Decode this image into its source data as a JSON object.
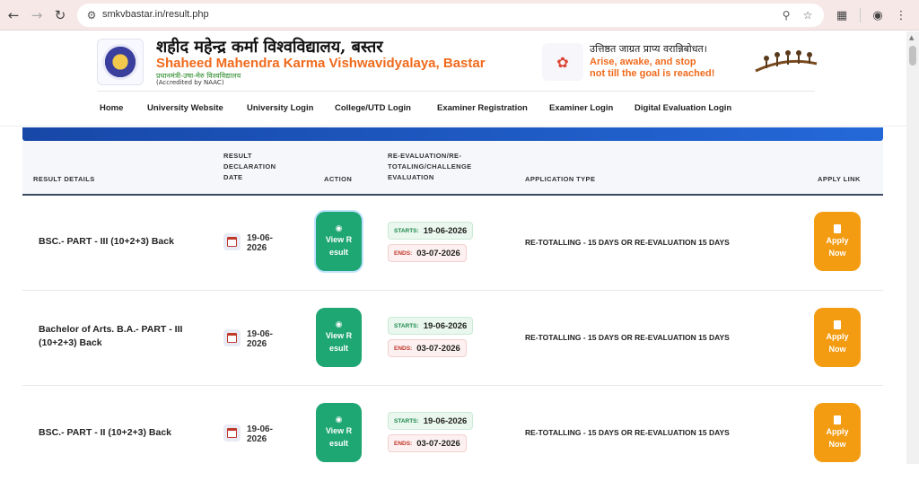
{
  "browser": {
    "url": "smkvbastar.in/result.php"
  },
  "header": {
    "title_hindi": "शहीद महेन्द्र कर्मा विश्वविद्यालय, बस्तर",
    "title_english": "Shaheed Mahendra Karma Vishwavidyalaya, Bastar",
    "subtitle_hindi": "प्रधानमंत्री-उषा-मेरु विश्वविद्यालय",
    "accreditation": "(Accredited by NAAC)",
    "motto_hindi": "उत्तिष्ठत जाग्रत प्राप्य वरान्निबोधत।",
    "motto_line1": "Arise, awake, and stop",
    "motto_line2": "not till the goal is reached!"
  },
  "menu": {
    "items": [
      "Home",
      "University Website",
      "University Login",
      "College/UTD Login",
      "Examiner Registration",
      "Examiner Login",
      "Digital Evaluation Login"
    ]
  },
  "table": {
    "headers": {
      "result_details": "RESULT DETAILS",
      "declaration_date": "RESULT DECLARATION DATE",
      "action": "ACTION",
      "reevaluation": "RE-EVALUATION/RE-TOTALING/CHALLENGE EVALUATION",
      "application_type": "APPLICATION TYPE",
      "apply_link": "APPLY LINK"
    },
    "labels": {
      "view_result": "View Result",
      "apply_now": "Apply Now",
      "starts": "STARTS:",
      "ends": "ENDS:"
    },
    "rows": [
      {
        "course": "BSC.- PART - III (10+2+3) Back",
        "date": "19-06-2026",
        "starts": "19-06-2026",
        "ends": "03-07-2026",
        "application_type": "RE-TOTALLING - 15 DAYS OR RE-EVALUATION 15 DAYS"
      },
      {
        "course": "Bachelor of Arts. B.A.- PART - III (10+2+3) Back",
        "date": "19-06-2026",
        "starts": "19-06-2026",
        "ends": "03-07-2026",
        "application_type": "RE-TOTALLING - 15 DAYS OR RE-EVALUATION 15 DAYS"
      },
      {
        "course": "BSC.- PART - II (10+2+3) Back",
        "date": "19-06-2026",
        "starts": "19-06-2026",
        "ends": "03-07-2026",
        "application_type": "RE-TOTALLING - 15 DAYS OR RE-EVALUATION 15 DAYS"
      }
    ]
  },
  "colors": {
    "accent_orange": "#f06a1c",
    "view_button": "#1ea673",
    "apply_button": "#f39c12",
    "band_blue": "#1748a8"
  }
}
